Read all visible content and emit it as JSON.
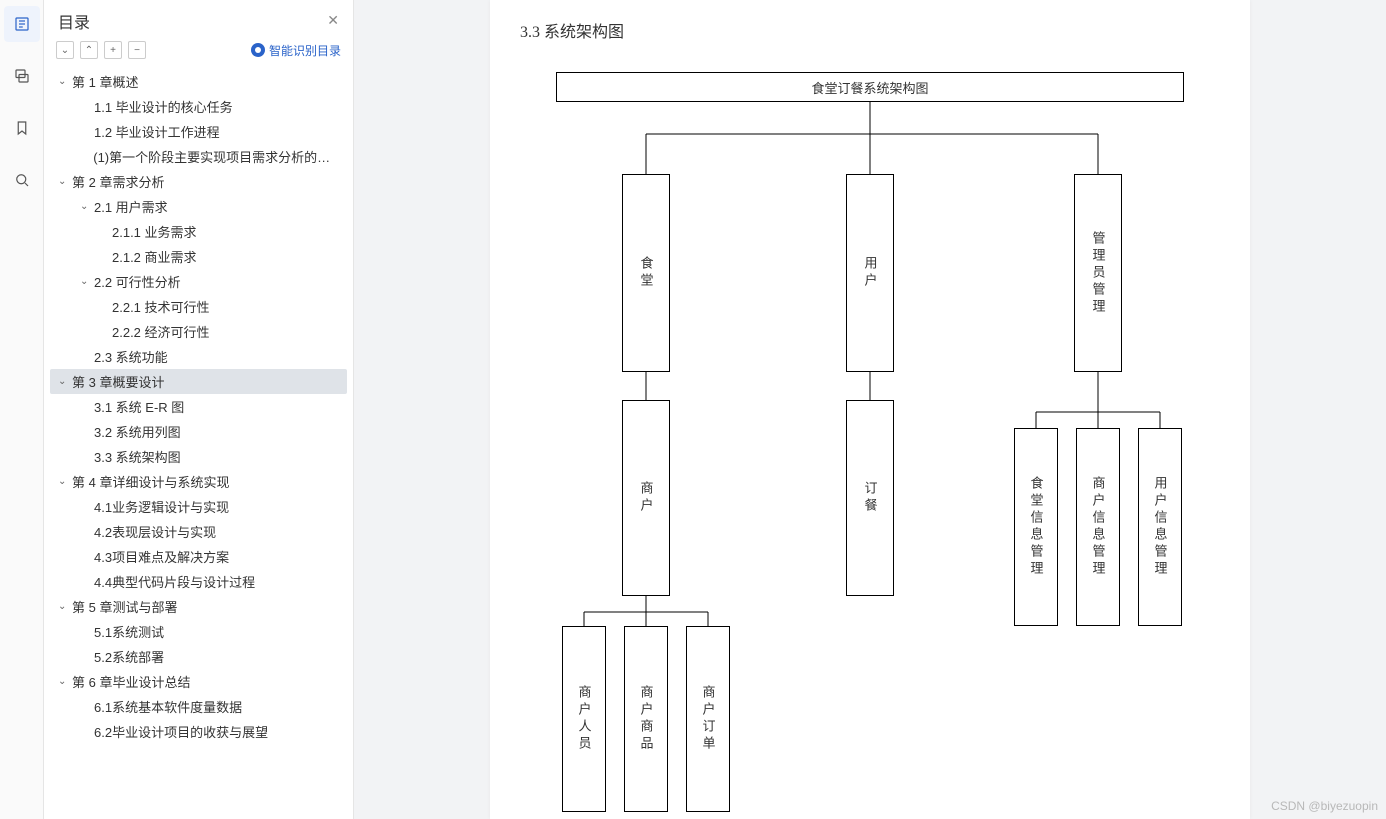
{
  "rail": {
    "items": [
      "outline-icon",
      "thumbnails-icon",
      "bookmark-icon",
      "search-icon"
    ]
  },
  "toc": {
    "title": "目录",
    "smart_link": "智能识别目录",
    "items": [
      {
        "level": 0,
        "caret": true,
        "label": "第 1 章概述",
        "selected": false
      },
      {
        "level": 1,
        "caret": false,
        "label": "1.1 毕业设计的核心任务"
      },
      {
        "level": 1,
        "caret": false,
        "label": "1.2 毕业设计工作进程"
      },
      {
        "level": 1,
        "caret": false,
        "label": "(1)第一个阶段主要实现项目需求分析的编写 ..."
      },
      {
        "level": 0,
        "caret": true,
        "label": "第 2 章需求分析"
      },
      {
        "level": 1,
        "caret": true,
        "label": "2.1 用户需求"
      },
      {
        "level": 2,
        "caret": false,
        "label": "2.1.1 业务需求"
      },
      {
        "level": 2,
        "caret": false,
        "label": "2.1.2 商业需求"
      },
      {
        "level": 1,
        "caret": true,
        "label": "2.2 可行性分析"
      },
      {
        "level": 2,
        "caret": false,
        "label": "2.2.1 技术可行性"
      },
      {
        "level": 2,
        "caret": false,
        "label": "2.2.2 经济可行性"
      },
      {
        "level": 1,
        "caret": false,
        "label": "2.3 系统功能"
      },
      {
        "level": 0,
        "caret": true,
        "label": "第 3 章概要设计",
        "selected": true
      },
      {
        "level": 1,
        "caret": false,
        "label": "3.1 系统 E-R 图"
      },
      {
        "level": 1,
        "caret": false,
        "label": "3.2 系统用列图"
      },
      {
        "level": 1,
        "caret": false,
        "label": "3.3 系统架构图"
      },
      {
        "level": 0,
        "caret": true,
        "label": "第 4 章详细设计与系统实现"
      },
      {
        "level": 1,
        "caret": false,
        "label": "4.1业务逻辑设计与实现"
      },
      {
        "level": 1,
        "caret": false,
        "label": "4.2表现层设计与实现"
      },
      {
        "level": 1,
        "caret": false,
        "label": "4.3项目难点及解决方案"
      },
      {
        "level": 1,
        "caret": false,
        "label": "4.4典型代码片段与设计过程"
      },
      {
        "level": 0,
        "caret": true,
        "label": "第 5 章测试与部署"
      },
      {
        "level": 1,
        "caret": false,
        "label": "5.1系统测试"
      },
      {
        "level": 1,
        "caret": false,
        "label": "5.2系统部署"
      },
      {
        "level": 0,
        "caret": true,
        "label": "第 6 章毕业设计总结"
      },
      {
        "level": 1,
        "caret": false,
        "label": "6.1系统基本软件度量数据"
      },
      {
        "level": 1,
        "caret": false,
        "label": "6.2毕业设计项目的收获与展望"
      }
    ]
  },
  "document": {
    "heading": "3.3 系统架构图",
    "diagram": {
      "root": "食堂订餐系统架构图",
      "level1": {
        "canteen": "食堂",
        "user": "用户",
        "admin": "管理员管理"
      },
      "level2": {
        "merchant": "商户",
        "order": "订餐"
      },
      "leaves_merchant": {
        "a": "商户人员",
        "b": "商户商品",
        "c": "商户订单"
      },
      "leaves_admin": {
        "a": "食堂信息管理",
        "b": "商户信息管理",
        "c": "用户信息管理"
      }
    }
  },
  "watermark": "CSDN @biyezuopin"
}
